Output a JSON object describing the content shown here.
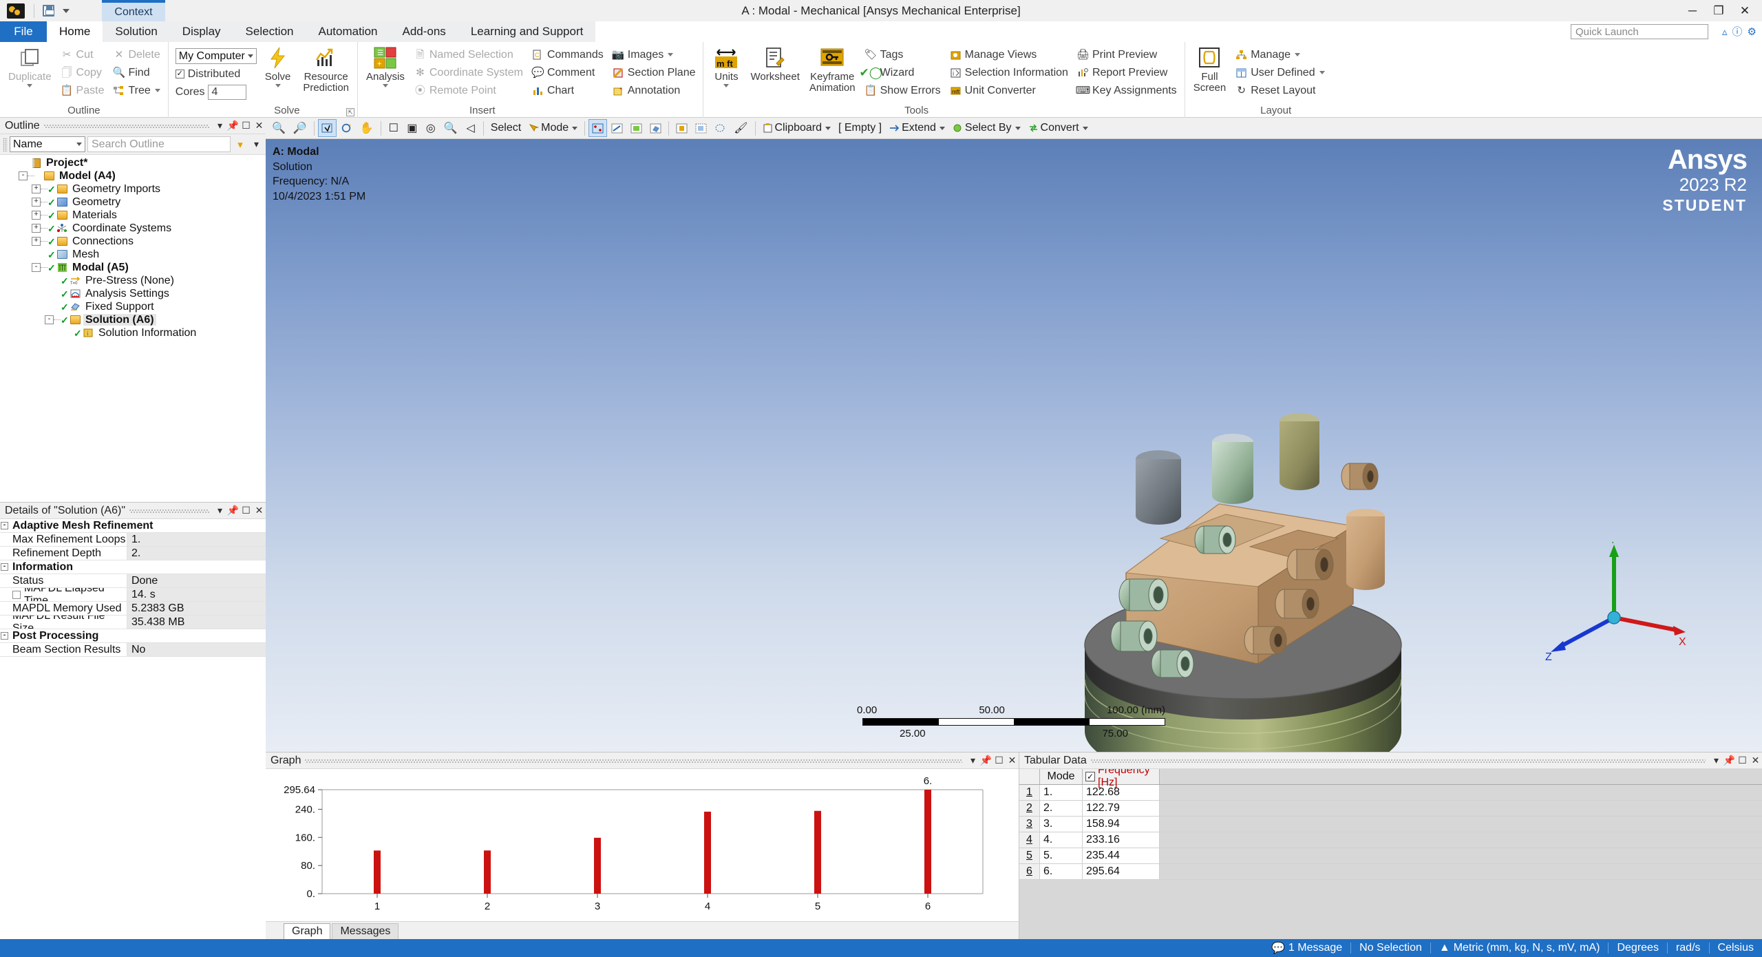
{
  "window": {
    "title": "A : Modal - Mechanical [Ansys Mechanical Enterprise]",
    "context_tab": "Context",
    "minimize": "─",
    "maximize": "❐",
    "close": "✕"
  },
  "quick_access": {
    "save_icon": "save-icon",
    "dropdown_icon": "chevron-down-icon"
  },
  "ribbon": {
    "tabs": [
      {
        "label": "File",
        "active": false
      },
      {
        "label": "Home",
        "active": true
      },
      {
        "label": "Solution",
        "active": false
      },
      {
        "label": "Display",
        "active": false
      },
      {
        "label": "Selection",
        "active": false
      },
      {
        "label": "Automation",
        "active": false
      },
      {
        "label": "Add-ons",
        "active": false
      },
      {
        "label": "Learning and Support",
        "active": false
      }
    ],
    "quick_launch_placeholder": "Quick Launch",
    "groups": {
      "outline": {
        "title": "Outline",
        "duplicate": "Duplicate",
        "cut": "Cut",
        "copy": "Copy",
        "paste": "Paste",
        "delete": "Delete",
        "find": "Find",
        "tree": "Tree"
      },
      "solve": {
        "title": "Solve",
        "computer": "My Computer",
        "distributed": "Distributed",
        "cores_label": "Cores",
        "cores_value": "4",
        "solve": "Solve",
        "resource_prediction_line1": "Resource",
        "resource_prediction_line2": "Prediction"
      },
      "insert": {
        "title": "Insert",
        "analysis": "Analysis",
        "named_selection": "Named Selection",
        "coordinate_system": "Coordinate System",
        "remote_point": "Remote Point",
        "commands": "Commands",
        "comment": "Comment",
        "chart": "Chart",
        "images": "Images",
        "section_plane": "Section Plane",
        "annotation": "Annotation"
      },
      "tools": {
        "title": "Tools",
        "units": "Units",
        "worksheet": "Worksheet",
        "keyframe_line1": "Keyframe",
        "keyframe_line2": "Animation",
        "tags": "Tags",
        "wizard": "Wizard",
        "show_errors": "Show Errors",
        "manage_views": "Manage Views",
        "selection_information": "Selection Information",
        "unit_converter": "Unit Converter",
        "print_preview": "Print Preview",
        "report_preview": "Report Preview",
        "key_assignments": "Key Assignments"
      },
      "layout": {
        "title": "Layout",
        "full_screen_line1": "Full",
        "full_screen_line2": "Screen",
        "manage": "Manage",
        "user_defined": "User Defined",
        "reset_layout": "Reset Layout"
      }
    }
  },
  "outline_panel": {
    "title": "Outline",
    "filter_value": "Name",
    "search_placeholder": "Search Outline",
    "tree": [
      {
        "label": "Project*",
        "depth": 0,
        "bold": true,
        "expander": "",
        "check": false,
        "icon": "project-icon",
        "selected": false
      },
      {
        "label": "Model (A4)",
        "depth": 1,
        "bold": true,
        "expander": "-",
        "check": false,
        "icon": "model-icon",
        "selected": false
      },
      {
        "label": "Geometry Imports",
        "depth": 2,
        "bold": false,
        "expander": "+",
        "check": true,
        "icon": "geometry-imports-icon",
        "selected": false
      },
      {
        "label": "Geometry",
        "depth": 2,
        "bold": false,
        "expander": "+",
        "check": true,
        "icon": "geometry-icon",
        "selected": false
      },
      {
        "label": "Materials",
        "depth": 2,
        "bold": false,
        "expander": "+",
        "check": true,
        "icon": "materials-icon",
        "selected": false
      },
      {
        "label": "Coordinate Systems",
        "depth": 2,
        "bold": false,
        "expander": "+",
        "check": true,
        "icon": "coordinate-systems-icon",
        "selected": false
      },
      {
        "label": "Connections",
        "depth": 2,
        "bold": false,
        "expander": "+",
        "check": true,
        "icon": "connections-icon",
        "selected": false
      },
      {
        "label": "Mesh",
        "depth": 2,
        "bold": false,
        "expander": "",
        "check": true,
        "icon": "mesh-icon",
        "selected": false
      },
      {
        "label": "Modal (A5)",
        "depth": 2,
        "bold": true,
        "expander": "-",
        "check": true,
        "icon": "modal-icon",
        "selected": false
      },
      {
        "label": "Pre-Stress (None)",
        "depth": 3,
        "bold": false,
        "expander": "",
        "check": true,
        "icon": "pre-stress-icon",
        "selected": false
      },
      {
        "label": "Analysis Settings",
        "depth": 3,
        "bold": false,
        "expander": "",
        "check": true,
        "icon": "analysis-settings-icon",
        "selected": false
      },
      {
        "label": "Fixed Support",
        "depth": 3,
        "bold": false,
        "expander": "",
        "check": true,
        "icon": "fixed-support-icon",
        "selected": false
      },
      {
        "label": "Solution (A6)",
        "depth": 3,
        "bold": true,
        "expander": "-",
        "check": true,
        "icon": "solution-icon",
        "selected": true
      },
      {
        "label": "Solution Information",
        "depth": 4,
        "bold": false,
        "expander": "",
        "check": true,
        "icon": "solution-information-icon",
        "selected": false
      }
    ]
  },
  "details_panel": {
    "title": "Details of \"Solution (A6)\"",
    "rows": [
      {
        "type": "group",
        "name": "Adaptive Mesh Refinement",
        "value": "",
        "expander": "-"
      },
      {
        "type": "item",
        "name": "Max Refinement Loops",
        "value": "1.",
        "checkbox": false
      },
      {
        "type": "item",
        "name": "Refinement Depth",
        "value": "2.",
        "checkbox": false
      },
      {
        "type": "group",
        "name": "Information",
        "value": "",
        "expander": "-"
      },
      {
        "type": "item",
        "name": "Status",
        "value": "Done",
        "checkbox": false
      },
      {
        "type": "item",
        "name": "MAPDL Elapsed Time",
        "value": "14. s",
        "checkbox": true
      },
      {
        "type": "item",
        "name": "MAPDL Memory Used",
        "value": "5.2383 GB",
        "checkbox": false
      },
      {
        "type": "item",
        "name": "MAPDL Result File Size",
        "value": "35.438 MB",
        "checkbox": false
      },
      {
        "type": "group",
        "name": "Post Processing",
        "value": "",
        "expander": "-"
      },
      {
        "type": "item",
        "name": "Beam Section Results",
        "value": "No",
        "checkbox": false
      }
    ]
  },
  "graphics_toolbar": {
    "zoom_in_icon": "zoom-in-icon",
    "zoom_out_icon": "zoom-out-icon",
    "select_label": "Select",
    "mode_label": "Mode",
    "clipboard_label": "Clipboard",
    "empty_label": "[ Empty ]",
    "extend_label": "Extend",
    "select_by_label": "Select By",
    "convert_label": "Convert"
  },
  "viewport": {
    "title": "A: Modal",
    "subtitle_1": "Solution",
    "subtitle_2": "Frequency: N/A",
    "subtitle_3": "10/4/2023 1:51 PM",
    "logo_line1": "Ansys",
    "logo_line2": "2023 R2",
    "logo_line3": "STUDENT",
    "scale": {
      "ticks_top": [
        "0.00",
        "50.00",
        "100.00 (mm)"
      ],
      "ticks_bottom": [
        "25.00",
        "75.00"
      ]
    },
    "triad": {
      "x": "X",
      "y": "Y",
      "z": "Z"
    }
  },
  "graph_panel": {
    "title": "Graph",
    "tabs": [
      {
        "label": "Graph",
        "active": true
      },
      {
        "label": "Messages",
        "active": false
      }
    ]
  },
  "chart_data": {
    "type": "bar",
    "title": "Graph",
    "categories": [
      "1",
      "2",
      "3",
      "4",
      "5",
      "6"
    ],
    "values": [
      122.68,
      122.79,
      158.94,
      233.16,
      235.44,
      295.64
    ],
    "xlabel": "",
    "ylabel": "",
    "ylim": [
      0,
      295.64
    ],
    "yticks": [
      "0.",
      "80.",
      "160.",
      "240.",
      "295.64"
    ],
    "ytick_values": [
      0,
      80,
      160,
      240,
      295.64
    ],
    "bar_color": "#cc1111",
    "annotations": [
      {
        "category": "6",
        "text": "6."
      }
    ],
    "grid": false,
    "legend": false
  },
  "tabular_panel": {
    "title": "Tabular Data",
    "columns": [
      "",
      "Mode",
      "Frequency [Hz]"
    ],
    "header_checkbox": true,
    "rows": [
      {
        "index": "1",
        "mode": "1.",
        "frequency": "122.68"
      },
      {
        "index": "2",
        "mode": "2.",
        "frequency": "122.79"
      },
      {
        "index": "3",
        "mode": "3.",
        "frequency": "158.94"
      },
      {
        "index": "4",
        "mode": "4.",
        "frequency": "233.16"
      },
      {
        "index": "5",
        "mode": "5.",
        "frequency": "235.44"
      },
      {
        "index": "6",
        "mode": "6.",
        "frequency": "295.64"
      }
    ]
  },
  "status_bar": {
    "messages": "1 Message",
    "selection": "No Selection",
    "units": "Metric (mm, kg, N, s, mV, mA)",
    "angle": "Degrees",
    "rotation": "rad/s",
    "temperature": "Celsius"
  }
}
